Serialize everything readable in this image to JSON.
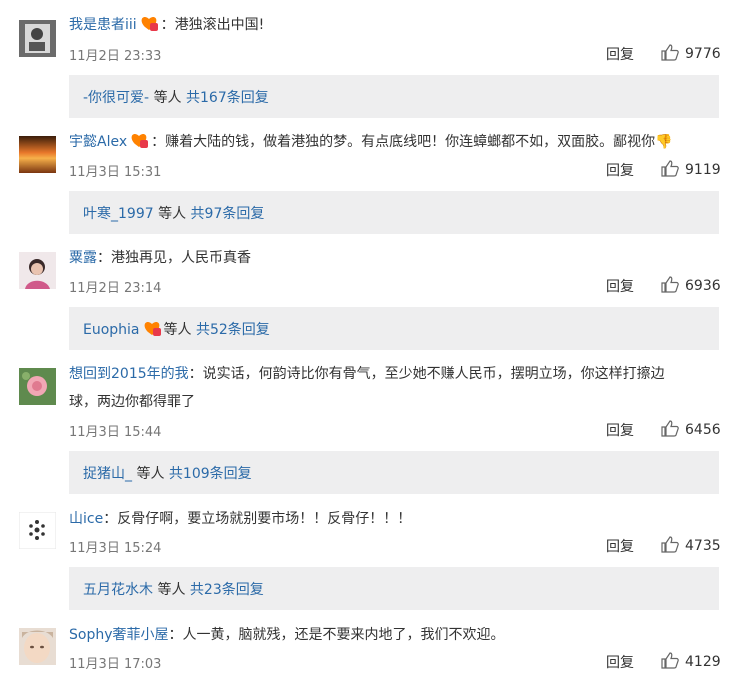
{
  "comments": [
    {
      "user": "我是患者iii",
      "badge": true,
      "text": "：港独滚出中国!",
      "time": "11月2日 23:33",
      "reply": "回复",
      "likes": "9776",
      "sub": {
        "user": "-你很可爱-",
        "badge": false,
        "middle": "等人",
        "total": "共167条回复"
      }
    },
    {
      "user": "宇懿Alex",
      "badge": true,
      "text": "：赚着大陆的钱，做着港独的梦。有点底线吧！你连蟑螂都不如，双面胶。鄙视你👎",
      "time": "11月3日 15:31",
      "reply": "回复",
      "likes": "9119",
      "sub": {
        "user": "叶寒_1997",
        "badge": false,
        "middle": "等人",
        "total": "共97条回复"
      }
    },
    {
      "user": "粟露",
      "badge": false,
      "text": "：港独再见，人民币真香",
      "time": "11月2日 23:14",
      "reply": "回复",
      "likes": "6936",
      "sub": {
        "user": "Euophia",
        "badge": true,
        "middle": "等人",
        "total": "共52条回复"
      }
    },
    {
      "user": "想回到2015年的我",
      "badge": false,
      "text": "：说实话，何韵诗比你有骨气，至少她不赚人民币，摆明立场，你这样打擦边",
      "text2": "球，两边你都得罪了",
      "time": "11月3日 15:44",
      "reply": "回复",
      "likes": "6456",
      "sub": {
        "user": "捉猪山_",
        "badge": false,
        "middle": "等人",
        "total": "共109条回复"
      }
    },
    {
      "user": "山ice",
      "badge": false,
      "text": "：反骨仔啊，要立场就别要市场！！反骨仔！！！",
      "time": "11月3日 15:24",
      "reply": "回复",
      "likes": "4735",
      "sub": {
        "user": "五月花水木",
        "badge": false,
        "middle": "等人",
        "total": "共23条回复"
      }
    },
    {
      "user": "Sophy奢菲小屋",
      "badge": false,
      "text": "：人一黄，脑就残，还是不要来内地了，我们不欢迎。",
      "time": "11月3日 17:03",
      "reply": "回复",
      "likes": "4129"
    }
  ]
}
